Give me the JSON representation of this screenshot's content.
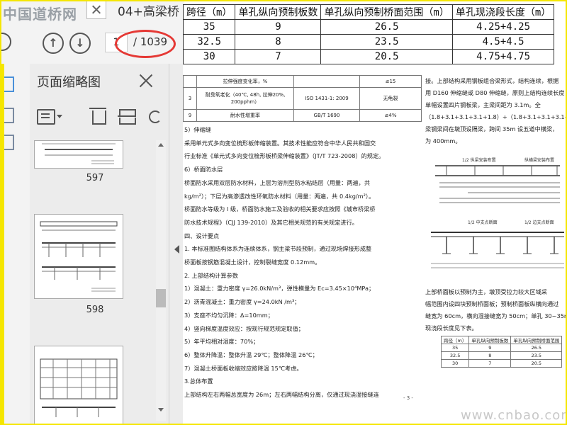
{
  "window": {
    "logo_text": "中国道桥网",
    "doc_title": "04+高梁桥"
  },
  "nav": {
    "current_page": "1",
    "page_total": "/ 1039"
  },
  "thumbnail_panel": {
    "title": "页面缩略图",
    "thumbnails": [
      {
        "page_number": "597"
      },
      {
        "page_number": "598"
      },
      {
        "page_number": ""
      }
    ]
  },
  "span_table": {
    "headers": [
      "跨径（m）",
      "单孔纵向预制板数",
      "单孔纵向预制桥面范围（m）",
      "单孔现浇段长度（m）"
    ],
    "rows": [
      [
        "35",
        "9",
        "26.5",
        "4.25+4.25"
      ],
      [
        "32.5",
        "8",
        "23.5",
        "4.5+4.5"
      ],
      [
        "30",
        "7",
        "20.5",
        "4.75+4.75"
      ]
    ]
  },
  "property_table": {
    "rows": [
      [
        "",
        "拉伸强度变化率，%",
        "",
        "≤15"
      ],
      [
        "3",
        "耐臭氧老化（40℃, 48h, 拉伸20%, 200pphm）",
        "ISO 1431-1: 2009",
        "无龟裂"
      ],
      [
        "9",
        "耐水性增重率",
        "GB/T 1690",
        "≤4%"
      ]
    ]
  },
  "document": {
    "lines": [
      "5）伸缩缝",
      "采用单元式多向变位梳形板伸缩装置。其技术性能应符合中华人民共和国交",
      "行业标准《单元式多向变位梳形板桥梁伸缩装置》（JT/T 723-2008）的规定。",
      "6）桥面防水层",
      "桥面防水采用双层防水材料，上层为溶剂型防水粘结层（用量：两遍，共",
      "kg/m²）；下层为高渗透改性环氧防水材料（用量：两遍，共 0.4kg/m²）。",
      "桥面防水等级为 I 级，桥面防水施工及验收的相关要求应按照《城市桥梁桥",
      "防水技术规程》（CJJ 139-2010）及其它相关规范的有关规定进行。",
      "四、设计要点",
      "1. 本标准图结构体系为连续体系，钢主梁节段预制，通过现场焊接形成整",
      "桥面板按钢筋混凝土设计，控制裂缝宽度 0.12mm。",
      "2. 上部结构计算参数",
      "1）混凝土：重力密度 γ=26.0kN/m³，弹性模量为 Ec=3.45×10⁴MPa；",
      "2）沥青混凝土：重力密度 γ=24.0kN /m³；",
      "3）支座不均匀沉降：Δ=10mm；",
      "4）竖向梯度温度效应：按现行规范规定取值；",
      "5）年平均相对湿度：70%；",
      "6）整体升降温：整体升温 29℃；整体降温 26℃；",
      "7）混凝土桥面板收缩效应按降温 15℃考虑。",
      "3.总体布置",
      "上部结构左右两幅总宽度为 26m；左右两幅结构分离，仅通过现浇湿接缝连"
    ],
    "right_lines": [
      "接。上部结构采用钢板组合梁形式，结构连续，根据",
      "用 D160 伸缩缝或 D80 伸缩缝，原则上结构连续长度",
      "单幅设置四片钢板梁，主梁间距为 3.1m。全",
      "（1.8+3.1+3.1+3.1+1.8）+（1.8+3.1+3.1+3.1+1.8",
      "梁钢梁间在墩顶设隔梁，跨间 35m 设五道中横梁，",
      "为 400mm。"
    ],
    "right_lines2": [
      "上部桥面板以预制为主，墩顶受拉力较大区域采",
      "幅范围内设四块预制桥面板；预制桥面板纵横向通过",
      "缝宽为 60cm，横向湿接缝宽为 50cm；单孔 30~35m 纵",
      "现浇段长度见下表。"
    ],
    "drawing_captions": [
      "1/2 纵梁安装布置",
      "纵横梁安装布置",
      "1/2 中支点断面",
      "1/2 边支点断面"
    ],
    "page_number": "- 3 -"
  },
  "small_table": {
    "headers": [
      "跨径（m）",
      "单孔纵向预制板数",
      "单孔纵向预制桥面范围"
    ],
    "rows": [
      [
        "35",
        "9",
        "26.5"
      ],
      [
        "32.5",
        "8",
        "23.5"
      ],
      [
        "30",
        "7",
        "20.5"
      ]
    ]
  },
  "watermark": "www.cnbao.com"
}
